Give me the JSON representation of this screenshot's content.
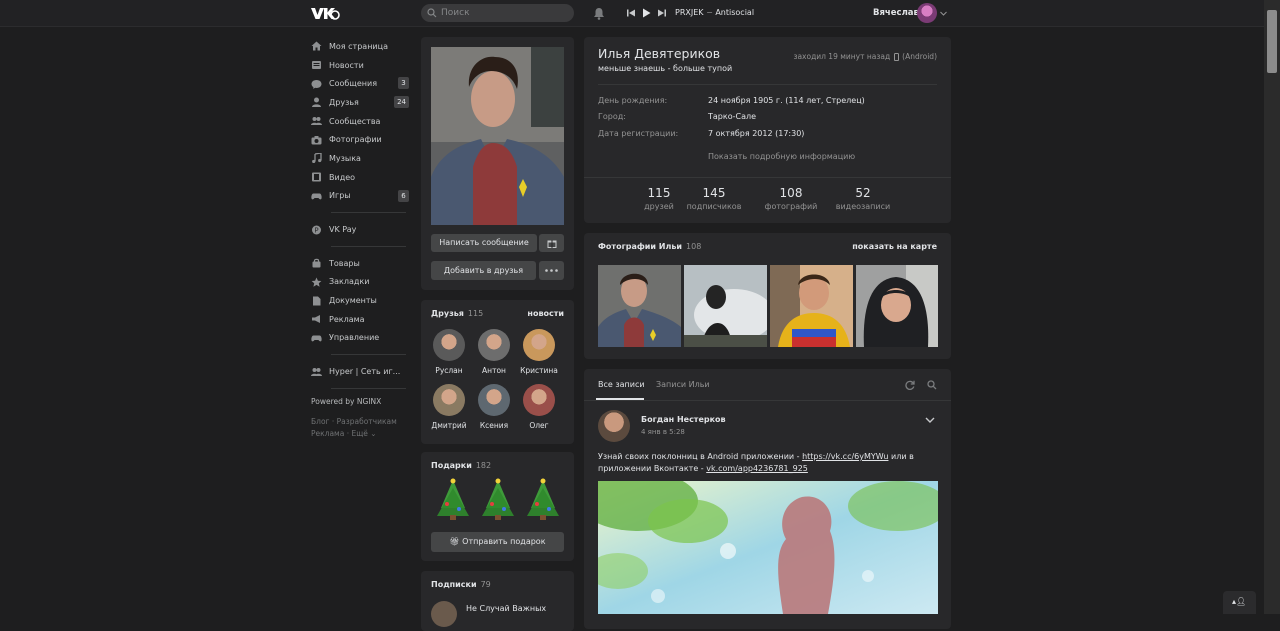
{
  "header": {
    "search_placeholder": "Поиск",
    "track_artist": "PRXJEK",
    "track_sep": " − ",
    "track_title": "Antisocial",
    "user_name": "Вячеслав"
  },
  "nav": {
    "items": [
      {
        "label": "Моя страница",
        "icon": "house-icon"
      },
      {
        "label": "Новости",
        "icon": "news-icon"
      },
      {
        "label": "Сообщения",
        "icon": "chat-bubble-icon",
        "count": "3"
      },
      {
        "label": "Друзья",
        "icon": "person-icon",
        "count": "24"
      },
      {
        "label": "Сообщества",
        "icon": "people-icon"
      },
      {
        "label": "Фотографии",
        "icon": "camera-icon"
      },
      {
        "label": "Музыка",
        "icon": "music-note-icon"
      },
      {
        "label": "Видео",
        "icon": "film-icon"
      },
      {
        "label": "Игры",
        "icon": "gamepad-icon",
        "count": "6"
      }
    ],
    "pay": {
      "label": "VK Pay",
      "icon": "vkpay-icon"
    },
    "items2": [
      {
        "label": "Товары",
        "icon": "bag-icon"
      },
      {
        "label": "Закладки",
        "icon": "star-icon"
      },
      {
        "label": "Документы",
        "icon": "document-icon"
      },
      {
        "label": "Реклама",
        "icon": "megaphone-icon"
      },
      {
        "label": "Управление",
        "icon": "gamepad-icon"
      }
    ],
    "community": {
      "label": "Hyper | Сеть иг...",
      "icon": "people-icon"
    },
    "powered": "Powered by NGINX",
    "footer_line1": "Блог · Разработчикам",
    "footer_line2": "Реклама · Ещё ⌄"
  },
  "profile": {
    "name": "Илья Девятериков",
    "status": "меньше знаешь - больше тупой",
    "last_seen": "заходил 19 минут назад",
    "device": "(Android)",
    "info": [
      {
        "label": "День рождения:",
        "value": "24 ноября 1905 г. (114 лет, Стрелец)"
      },
      {
        "label": "Город:",
        "value": "Тарко-Сале"
      },
      {
        "label": "Дата регистрации:",
        "value": "7 октября 2012 (17:30)"
      }
    ],
    "more_info": "Показать подробную информацию",
    "counters": [
      {
        "n": "115",
        "l": "друзей"
      },
      {
        "n": "145",
        "l": "подписчиков"
      },
      {
        "n": "108",
        "l": "фотографий"
      },
      {
        "n": "52",
        "l": "видеозаписи"
      }
    ]
  },
  "actions": {
    "write_message": "Написать сообщение",
    "add_friend": "Добавить в друзья"
  },
  "friends": {
    "title": "Друзья",
    "count": "115",
    "news_link": "новости",
    "people": [
      {
        "name": "Руслан",
        "color": "#5a5a5a"
      },
      {
        "name": "Антон",
        "color": "#6d6d6d"
      },
      {
        "name": "Кристина",
        "color": "#c9985c"
      },
      {
        "name": "Дмитрий",
        "color": "#8a7a62"
      },
      {
        "name": "Ксения",
        "color": "#5e6870"
      },
      {
        "name": "Олег",
        "color": "#9a4f4a"
      }
    ]
  },
  "gifts": {
    "title": "Подарки",
    "count": "182",
    "send": "Отправить подарок"
  },
  "subs": {
    "title": "Подписки",
    "count": "79",
    "first": "Не Случай Важных"
  },
  "photos": {
    "title": "Фотографии Ильи",
    "count": "108",
    "map_link": "показать на карте"
  },
  "wall": {
    "tab_all": "Все записи",
    "tab_own": "Записи Ильи",
    "post": {
      "author": "Богдан Нестерков",
      "date": "4 янв в 5:28",
      "text_before": "Узнай своих поклонниц в Android приложении - ",
      "link1": "https://vk.cc/6yMYWu",
      "text_middle": " или в приложении Вконтакте - ",
      "link2": "vk.com/app4236781_925"
    }
  }
}
